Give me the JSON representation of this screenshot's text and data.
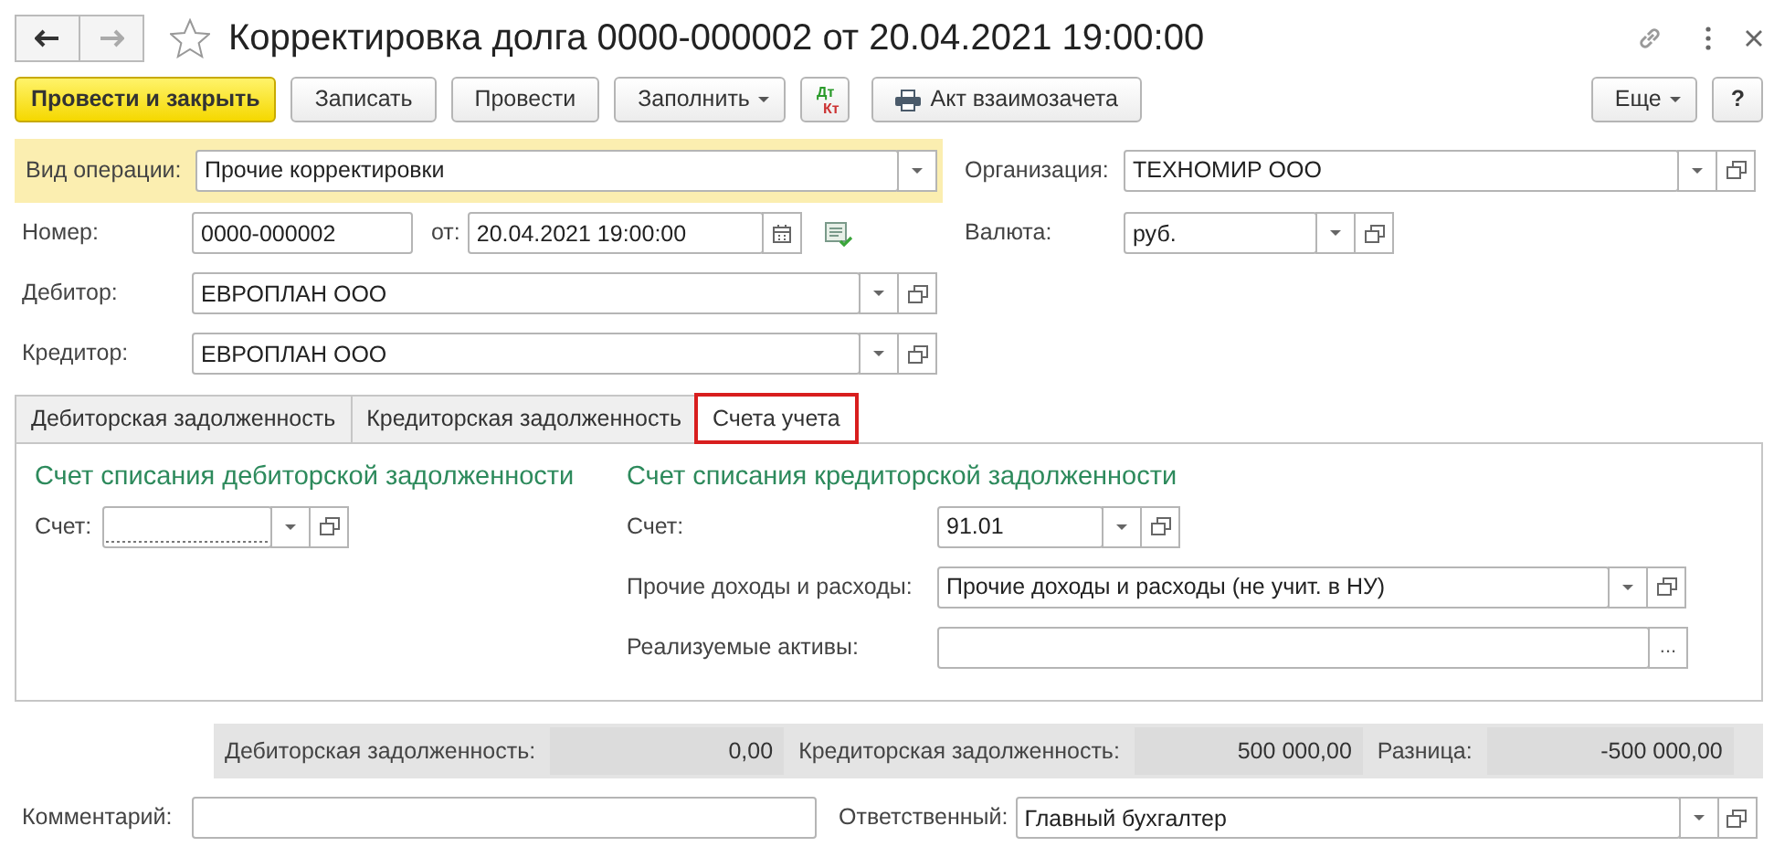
{
  "window": {
    "title": "Корректировка долга 0000-000002 от 20.04.2021 19:00:00",
    "back_enabled": true,
    "forward_enabled": false,
    "favorite": false
  },
  "toolbar": [
    {
      "kind": "primary",
      "label": "Провести и закрыть"
    },
    {
      "kind": "plain",
      "label": "Записать"
    },
    {
      "kind": "plain",
      "label": "Провести"
    },
    {
      "kind": "menu",
      "label": "Заполнить"
    },
    {
      "kind": "dtkt",
      "label": "Дт",
      "label2": "Кт"
    },
    {
      "kind": "print",
      "label": "Акт взаимозачета"
    },
    {
      "kind": "spacer"
    },
    {
      "kind": "menu",
      "label": "Еще"
    },
    {
      "kind": "help",
      "label": "?"
    }
  ],
  "header": {
    "operation": {
      "label": "Вид операции:",
      "value": "Прочие корректировки",
      "buttons": [
        {
          "kind": "dropdown"
        }
      ]
    },
    "organization": {
      "label": "Организация:",
      "value": "ТЕХНОМИР ООО",
      "buttons": [
        {
          "kind": "dropdown"
        },
        {
          "kind": "open"
        }
      ]
    },
    "number": {
      "label": "Номер:",
      "value": "0000-000002"
    },
    "date": {
      "label": "от:",
      "value": "20.04.2021 19:00:00",
      "buttons": [
        {
          "kind": "calendar"
        }
      ]
    },
    "currency": {
      "label": "Валюта:",
      "value": "руб.",
      "buttons": [
        {
          "kind": "dropdown"
        },
        {
          "kind": "open"
        }
      ]
    },
    "debtor": {
      "label": "Дебитор:",
      "value": "ЕВРОПЛАН ООО",
      "buttons": [
        {
          "kind": "dropdown"
        },
        {
          "kind": "open"
        }
      ]
    },
    "creditor": {
      "label": "Кредитор:",
      "value": "ЕВРОПЛАН ООО",
      "buttons": [
        {
          "kind": "dropdown"
        },
        {
          "kind": "open"
        }
      ]
    }
  },
  "tabs": [
    {
      "label": "Дебиторская задолженность",
      "selected": false,
      "highlighted": false
    },
    {
      "label": "Кредиторская задолженность",
      "selected": false,
      "highlighted": false
    },
    {
      "label": "Счета учета",
      "selected": true,
      "highlighted": true
    }
  ],
  "accounts": {
    "left": {
      "title": "Счет списания дебиторской задолженности",
      "fields": [
        {
          "label": "Счет:",
          "required": true,
          "buttons": [
            {
              "kind": "dropdown"
            },
            {
              "kind": "open"
            }
          ]
        }
      ]
    },
    "right": {
      "title": "Счет списания кредиторской задолженности",
      "fields": [
        {
          "label": "Счет:",
          "value": "91.01",
          "buttons": [
            {
              "kind": "dropdown"
            },
            {
              "kind": "open"
            }
          ]
        },
        {
          "label": "Прочие доходы и расходы:",
          "value": "Прочие доходы и расходы (не учит. в НУ)",
          "buttons": [
            {
              "kind": "dropdown"
            },
            {
              "kind": "open"
            }
          ]
        },
        {
          "label": "Реализуемые активы:",
          "buttons": [
            {
              "kind": "choose",
              "label": "..."
            }
          ]
        }
      ]
    }
  },
  "totals": [
    {
      "label": "Дебиторская задолженность:",
      "value": "0,00"
    },
    {
      "label": "Кредиторская задолженность:",
      "value": "500 000,00"
    },
    {
      "label": "Разница:",
      "value": "-500 000,00"
    }
  ],
  "footer": {
    "comment": {
      "label": "Комментарий:"
    },
    "responsible": {
      "label": "Ответственный:",
      "value": "Главный бухгалтер",
      "buttons": [
        {
          "kind": "dropdown"
        },
        {
          "kind": "open"
        }
      ]
    }
  }
}
